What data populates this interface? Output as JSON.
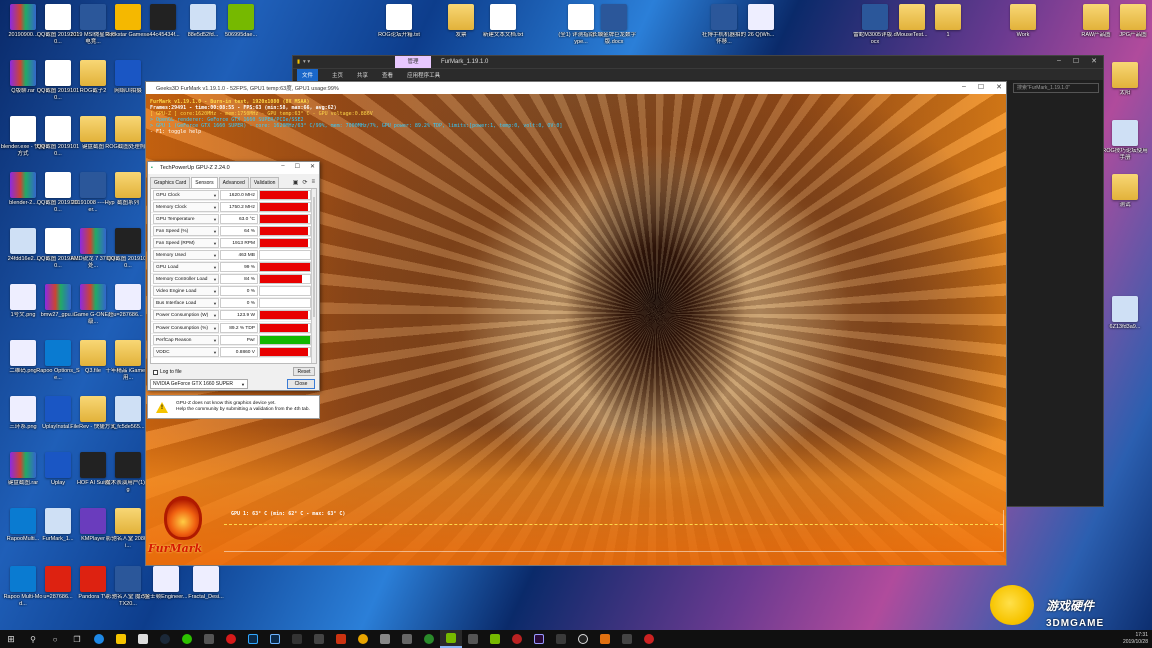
{
  "desktop": {
    "icons_col1": [
      "20190900...",
      "Q版聊.rar",
      "blender.exe - 快捷方式",
      "blender-2...",
      "24fdd16e2...",
      "1号文.png",
      "二维码.png",
      "三环系.png",
      "键盘截图.rar",
      "RapooMulti...",
      "Rapoo Multi-Mod..."
    ],
    "icons_col2": [
      "QQ截图 20191010...",
      "QQ截图 20191010...",
      "QQ截图 20191010...",
      "QQ截图 20191010...",
      "QQ截图 20191010...",
      "bmw27_gpu...",
      "Rapoo Options_Se...",
      "UplayInstal...",
      "Uplay",
      "FurMark_1...",
      "u=287686..."
    ],
    "icons_col3": [
      "2019 MSI微星世界电竞...",
      "ROG截子2",
      "键盘截图",
      "20191008 ----Hyper...",
      "AMD锐龙 7 3700X处...",
      "iGame G-ONE超级...",
      "Q3.file",
      "FileRev - 快捷方式",
      "HOF AI Suite",
      "KMPlayer",
      "Pandora TV"
    ],
    "icons_col4": [
      "Rockstar Games...",
      "网络UI拍摄",
      "ROG截图处理照子",
      "截图系列",
      "QQ截图 20191010...",
      "u=287686...",
      "十年精品 iGame耐用...",
      "s_fc5de565...",
      "魔术表演用户(1).jpg",
      "影驰名人堂 2080Ti...",
      "影驰名人堂 魔改RTX20..."
    ],
    "icons_col5": [
      "e44c45434f...",
      "",
      "",
      "",
      "",
      "",
      "",
      "",
      "",
      "",
      "金士顿Engineer..."
    ],
    "icons_col6": [
      "88e5d52fd...",
      "",
      "",
      "",
      "",
      "",
      "",
      "",
      "",
      "",
      "Fractal_Desi..."
    ],
    "icons_col7": [
      "506995dae...",
      "",
      "",
      "",
      "",
      "",
      "",
      "",
      "",
      "",
      ""
    ],
    "top_icons": [
      "ROG论坛开箱.txt",
      "新建文本文档.txt",
      "(全1) 详测指南：Hype...",
      "长城金牌巨龙数字版.docx",
      "社博手机机器拍的怀移...",
      "26 Q(Wh...",
      "雷蛇M3005详版.docx",
      "MouseTest...",
      "1",
      "Work",
      "RAW产品图",
      "JPG产品图"
    ],
    "folder_label": "发票",
    "right_icons": [
      "太阳",
      "ROG技巧论坛使用手册",
      "测试",
      "6Z13fd3a9..."
    ]
  },
  "explorer": {
    "manage_tab": "管理",
    "title": "FurMark_1.19.1.0",
    "ribbon": [
      "文件",
      "主页",
      "共享",
      "查看",
      "应用程序工具"
    ],
    "search_placeholder": "搜索\"FurMark_1.19.1.0\""
  },
  "furmark": {
    "title": "Geeks3D FurMark v1.19.1.0 - 52FPS, GPU1 temp:63度, GPU1 usage:99%",
    "overlay": [
      "FurMark v1.19.1.0 - Burn-in test, 1920x1080 (8X MSAA)",
      "Frames:29491 - time:00:08:55 - FPS:63 (min:58, max:66, avg:62)",
      "[ GPU-Z ] core:1620MHz - mem:1750MHz - GPU temp:63° C - GPU voltage:0.886V",
      "> OpenGL renderer: GeForce GTX 1660 SUPER/PCIe/SSE2",
      "> GPU 1 (GeForce GTX 1660 SUPER) - core: 1620MHz/63° C/99%, mem: 7000MHz/7%, GPU power: 89.2% TDP, limits:[power:1, temp:0, volt:0, OV:0]",
      "- F1: toggle help"
    ],
    "temp_graph_label": "GPU 1: 63° C (min: 62° C - max: 63° C)",
    "logo_text": "FurMark",
    "temp_line_level": 0.63
  },
  "gpuz": {
    "title": "TechPowerUp GPU-Z 2.24.0",
    "tabs": [
      "Graphics Card",
      "Sensors",
      "Advanced",
      "Validation"
    ],
    "active_tab": "Sensors",
    "sensors": [
      {
        "name": "GPU Clock",
        "value": "1620.0 MHz",
        "fill": 0.95,
        "color": "red"
      },
      {
        "name": "Memory Clock",
        "value": "1750.2 MHz",
        "fill": 0.95,
        "color": "red"
      },
      {
        "name": "GPU Temperature",
        "value": "63.0 °C",
        "fill": 0.95,
        "color": "red"
      },
      {
        "name": "Fan Speed (%)",
        "value": "64 %",
        "fill": 0.95,
        "color": "red"
      },
      {
        "name": "Fan Speed (RPM)",
        "value": "1913 RPM",
        "fill": 0.95,
        "color": "red"
      },
      {
        "name": "Memory Used",
        "value": "463 MB",
        "fill": 0.0,
        "color": "red"
      },
      {
        "name": "GPU Load",
        "value": "99 %",
        "fill": 0.99,
        "color": "red"
      },
      {
        "name": "Memory Controller Load",
        "value": "84 %",
        "fill": 0.84,
        "color": "red"
      },
      {
        "name": "Video Engine Load",
        "value": "0 %",
        "fill": 0.0,
        "color": "red"
      },
      {
        "name": "Bus Interface Load",
        "value": "0 %",
        "fill": 0.0,
        "color": "red"
      },
      {
        "name": "Power Consumption (W)",
        "value": "123.9 W",
        "fill": 0.95,
        "color": "red"
      },
      {
        "name": "Power Consumption (%)",
        "value": "89.2 % TDP",
        "fill": 0.95,
        "color": "red"
      },
      {
        "name": "PerfCap Reason",
        "value": "Pwr",
        "fill": 1.0,
        "color": "green"
      },
      {
        "name": "VDDC",
        "value": "0.8860 V",
        "fill": 0.95,
        "color": "red"
      }
    ],
    "log_label": "Log to file",
    "reset_label": "Reset",
    "gpu_select": "NVIDIA GeForce GTX 1660 SUPER",
    "close_label": "Close",
    "warning_line1": "GPU-Z does not know this graphics device yet.",
    "warning_line2": "Help the community by submitting a validation from the 4th tab."
  },
  "taskbar": {
    "time": "17:31",
    "date": "2019/10/28"
  },
  "watermark": {
    "cn": "游戏硬件",
    "en": "3DMGAME"
  }
}
